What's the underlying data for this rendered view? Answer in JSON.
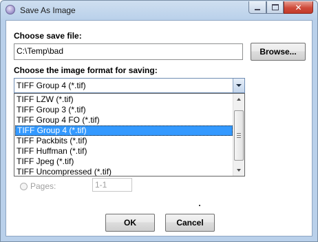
{
  "window": {
    "title": "Save As Image"
  },
  "save_file": {
    "label": "Choose save file:",
    "path": "C:\\Temp\\bad",
    "browse_label": "Browse..."
  },
  "format": {
    "label": "Choose the image format for saving:",
    "selected": "TIFF Group 4 (*.tif)",
    "options": [
      "TIFF LZW (*.tif)",
      "TIFF Group 3 (*.tif)",
      "TIFF Group 4 FO (*.tif)",
      "TIFF Group 4 (*.tif)",
      "TIFF Packbits (*.tif)",
      "TIFF Huffman (*.tif)",
      "TIFF Jpeg (*.tif)",
      "TIFF Uncompressed (*.tif)"
    ],
    "highlighted_index": 3
  },
  "pages": {
    "label": "Pages:",
    "value": "1-1"
  },
  "footer": {
    "ok_label": "OK",
    "cancel_label": "Cancel"
  }
}
